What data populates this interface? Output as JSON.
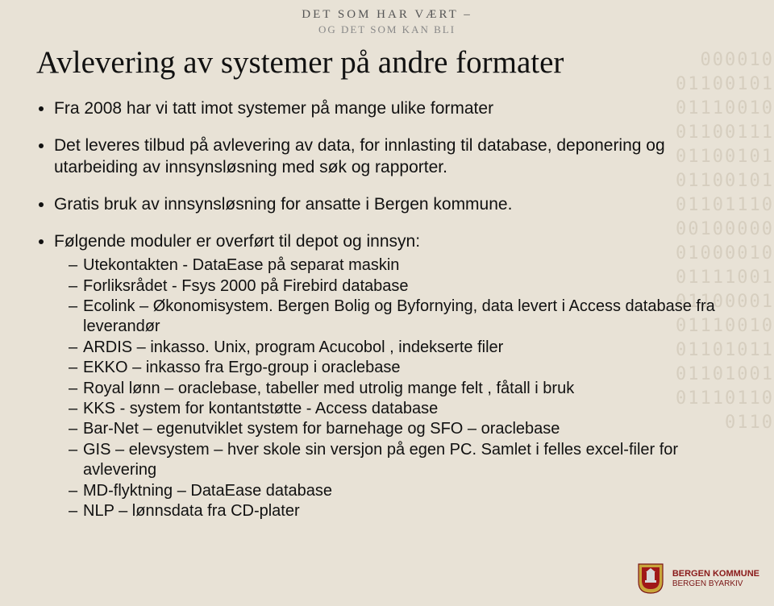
{
  "header": {
    "line1": "DET SOM HAR VÆRT –",
    "line2": "OG DET SOM KAN BLI"
  },
  "title": "Avlevering av systemer på andre formater",
  "bullets": [
    "Fra 2008 har vi tatt imot systemer på mange ulike formater",
    "Det leveres tilbud på avlevering av data, for innlasting til database, deponering og utarbeiding av innsynsløsning med søk og rapporter.",
    "Gratis bruk av innsynsløsning for ansatte i Bergen kommune.",
    "Følgende moduler er overført til depot og innsyn:"
  ],
  "sub_bullets": [
    "Utekontakten - DataEase på separat maskin",
    "Forliksrådet -  Fsys 2000 på Firebird database",
    "Ecolink – Økonomisystem. Bergen Bolig og Byfornying, data levert i Access database fra leverandør",
    "ARDIS – inkasso. Unix, program Acucobol , indekserte filer",
    "EKKO – inkasso fra Ergo-group i oraclebase",
    "Royal lønn – oraclebase, tabeller med utrolig mange felt , fåtall i bruk",
    "KKS -  system for kontantstøtte -  Access database",
    "Bar-Net – egenutviklet system for barnehage og SFO –  oraclebase",
    "GIS – elevsystem –  hver skole sin versjon på egen PC. Samlet i felles excel-filer for avlevering",
    "MD-flyktning – DataEase database",
    "NLP – lønnsdata fra CD-plater"
  ],
  "footer": {
    "org": "BERGEN KOMMUNE",
    "dept": "BERGEN BYARKIV"
  },
  "bg_binary": "000010\n01100101\n01110010\n01100111\n01100101\n01100101\n01101110\n00100000\n01000010\n01111001\n01100001\n01110010\n01101011\n01101001\n01110110\n0110"
}
